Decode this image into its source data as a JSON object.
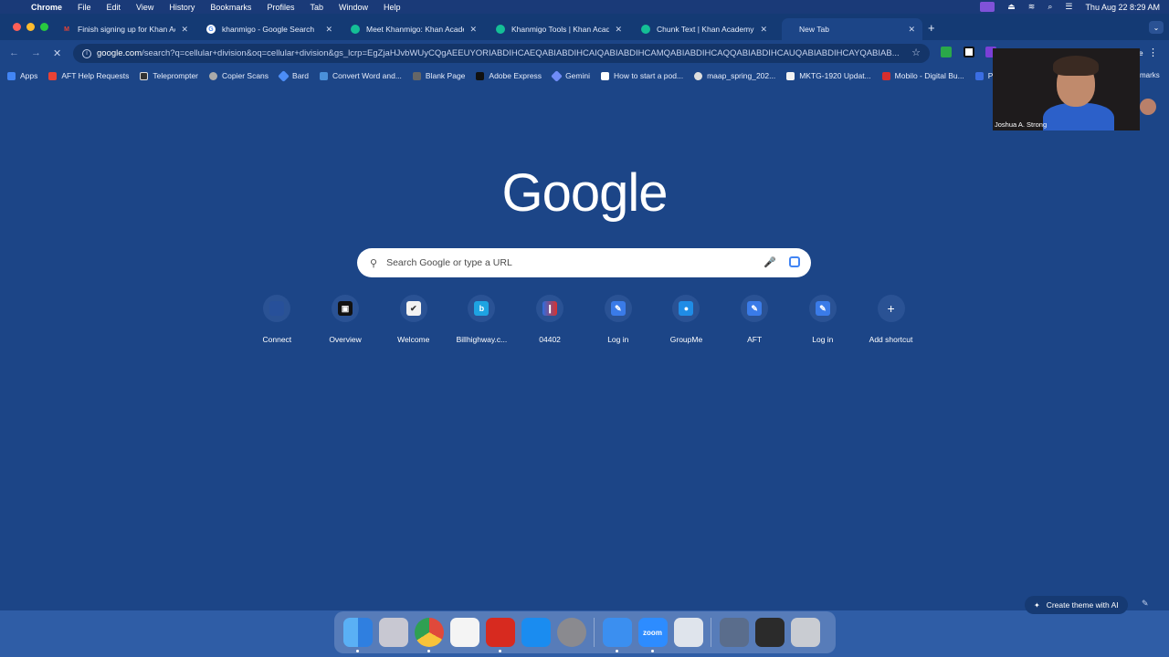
{
  "menubar": {
    "app": "Chrome",
    "items": [
      "File",
      "Edit",
      "View",
      "History",
      "Bookmarks",
      "Profiles",
      "Tab",
      "Window",
      "Help"
    ],
    "datetime": "Thu Aug 22  8:29 AM"
  },
  "tabs": [
    {
      "title": "Finish signing up for Khan Ac",
      "icon": "gmail-icon",
      "color": "#ea4335"
    },
    {
      "title": "khanmigo - Google Search",
      "icon": "google-icon",
      "color": "#ffffff"
    },
    {
      "title": "Meet Khanmigo: Khan Acade",
      "icon": "khan-icon",
      "color": "#14bf96"
    },
    {
      "title": "Khanmigo Tools | Khan Acade",
      "icon": "khan-icon",
      "color": "#14bf96"
    },
    {
      "title": "Chunk Text | Khan Academy",
      "icon": "khan-icon",
      "color": "#14bf96"
    },
    {
      "title": "New Tab",
      "icon": "none",
      "color": "#1c4587"
    }
  ],
  "new_tab_symbol": "+",
  "toolbar": {
    "url_domain": "google.com",
    "url_rest": "/search?q=cellular+division&oq=cellular+division&gs_lcrp=EgZjaHJvbWUyCQgAEEUYORIABDIHCAEQABIABDIHCAIQABIABDIHCAMQABIABDIHCAQQABIABDIHCAUQABIABDIHCAYQABIAB...",
    "partial_right": "le"
  },
  "bookmarks": [
    {
      "label": "Apps",
      "color": "#4285f4"
    },
    {
      "label": "AFT Help Requests",
      "color": "#e94235"
    },
    {
      "label": "Teleprompter",
      "color": "#333333"
    },
    {
      "label": "Copier Scans",
      "color": "#aaaaaa"
    },
    {
      "label": "Bard",
      "color": "#4c8df6"
    },
    {
      "label": "Convert Word and...",
      "color": "#4a90d9"
    },
    {
      "label": "Blank Page",
      "color": "#666666"
    },
    {
      "label": "Adobe Express",
      "color": "#111111"
    },
    {
      "label": "Gemini",
      "color": "#6f8cf6"
    },
    {
      "label": "How to start a pod...",
      "color": "#ffffff"
    },
    {
      "label": "maap_spring_202...",
      "color": "#dddddd"
    },
    {
      "label": "MKTG-1920 Updat...",
      "color": "#f2f2f2"
    },
    {
      "label": "Mobilo - Digital Bu...",
      "color": "#d62e2e"
    },
    {
      "label": "Pro",
      "color": "#3b6ee3"
    }
  ],
  "bookmarks_overflow": "marks",
  "page": {
    "logo": "Google",
    "search_placeholder": "Search Google or type a URL"
  },
  "shortcuts": [
    {
      "label": "Connect",
      "icon": "connect-icon",
      "color": "#27509a",
      "glyph": ""
    },
    {
      "label": "Overview",
      "icon": "overview-icon",
      "color": "#111111",
      "glyph": "▣"
    },
    {
      "label": "Welcome",
      "icon": "welcome-icon",
      "color": "#f2f2f2",
      "glyph": "✔"
    },
    {
      "label": "Billhighway.c...",
      "icon": "billhighway-icon",
      "color": "#1ea3e2",
      "glyph": "b"
    },
    {
      "label": "04402",
      "icon": "04402-icon",
      "color": "#7b3fd6",
      "glyph": "❙"
    },
    {
      "label": "Log in",
      "icon": "login-icon",
      "color": "#3a7be8",
      "glyph": "✎"
    },
    {
      "label": "GroupMe",
      "icon": "groupme-icon",
      "color": "#1f8ce6",
      "glyph": "●"
    },
    {
      "label": "AFT",
      "icon": "aft-icon",
      "color": "#3a7be8",
      "glyph": "✎"
    },
    {
      "label": "Log in",
      "icon": "login-icon",
      "color": "#3a7be8",
      "glyph": "✎"
    },
    {
      "label": "Add shortcut",
      "icon": "plus-icon",
      "color": "#2a5294",
      "glyph": "+"
    }
  ],
  "theme_button": "Create theme with AI",
  "video": {
    "name": "Joshua A. Strong"
  },
  "dock": [
    {
      "icon": "finder-icon",
      "color": "#3d8ee8",
      "running": true
    },
    {
      "icon": "launchpad-icon",
      "color": "#c8c8d2",
      "running": false
    },
    {
      "icon": "chrome-icon",
      "color": "#e0493b",
      "running": true
    },
    {
      "icon": "textedit-icon",
      "color": "#f4f4f4",
      "running": false
    },
    {
      "icon": "acrobat-icon",
      "color": "#d72a1f",
      "running": true
    },
    {
      "icon": "appstore-icon",
      "color": "#1a8cf0",
      "running": false
    },
    {
      "icon": "settings-icon",
      "color": "#8a8a8f",
      "running": false
    },
    {
      "icon": "mail-icon",
      "color": "#3b8ff0",
      "running": true
    },
    {
      "icon": "zoom-icon",
      "color": "#2d8cff",
      "running": true,
      "label": "zoom"
    },
    {
      "icon": "preview-icon",
      "color": "#dfe4ec",
      "running": false
    },
    {
      "icon": "window-thumbnail-icon",
      "color": "#5a6d8c",
      "running": false
    },
    {
      "icon": "window-thumbnail-icon",
      "color": "#2b2b2b",
      "running": false
    },
    {
      "icon": "trash-icon",
      "color": "#c9ccd2",
      "running": false
    }
  ]
}
